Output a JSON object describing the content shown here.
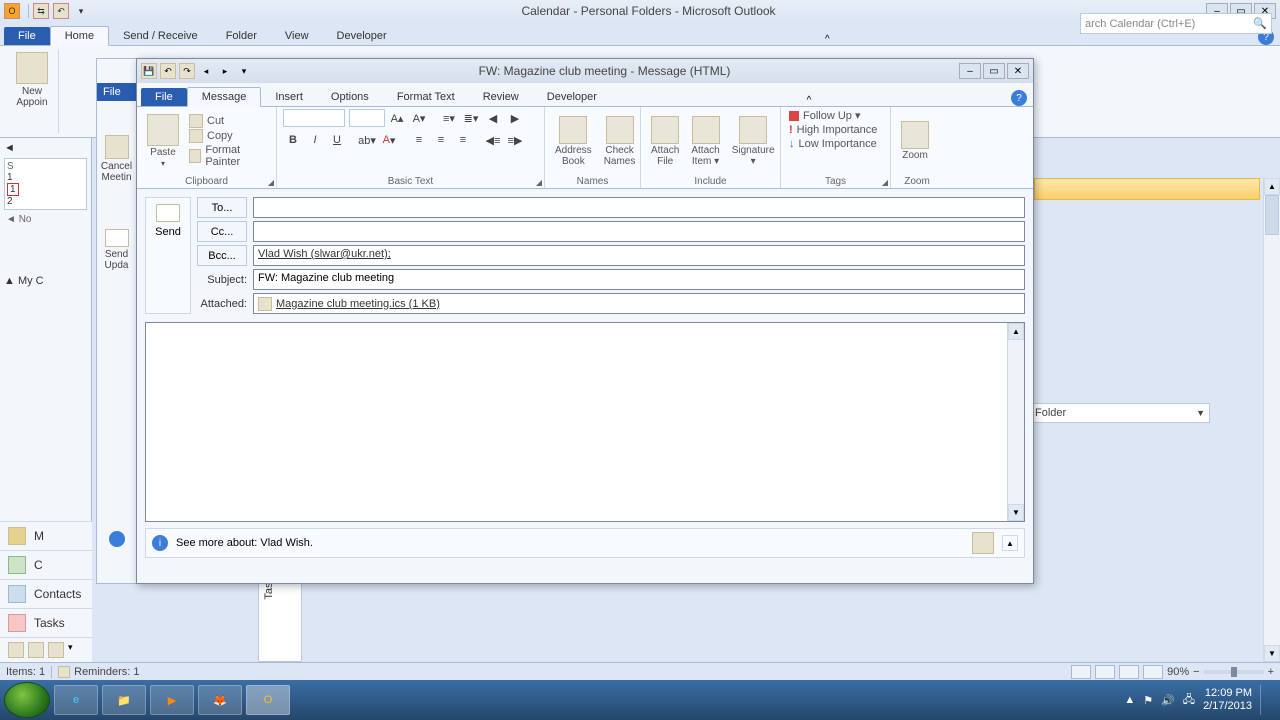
{
  "main": {
    "title": "Calendar - Personal Folders  -  Microsoft Outlook",
    "tabs": {
      "file": "File",
      "home": "Home",
      "send_receive": "Send / Receive",
      "folder": "Folder",
      "view": "View",
      "developer": "Developer"
    },
    "new_appt": "New\nAppoin",
    "search_placeholder": "arch Calendar (Ctrl+E)",
    "nav": {
      "mail": "M",
      "calendar": "C",
      "contacts": "Contacts",
      "tasks": "Tasks",
      "my_c": "My C",
      "nov": "No"
    },
    "folder_label": "Folder",
    "task_tab": "Task"
  },
  "peek": {
    "file": "File",
    "cancel": "Cancel\nMeetin",
    "update": "Send\nUpda"
  },
  "status": {
    "items": "Items: 1",
    "reminders": "Reminders: 1",
    "zoom": "90%"
  },
  "msg": {
    "title": "FW: Magazine club meeting  -  Message (HTML)",
    "tabs": {
      "file": "File",
      "message": "Message",
      "insert": "Insert",
      "options": "Options",
      "format": "Format Text",
      "review": "Review",
      "developer": "Developer"
    },
    "clipboard": {
      "paste": "Paste",
      "cut": "Cut",
      "copy": "Copy",
      "fp": "Format Painter",
      "label": "Clipboard"
    },
    "basic_text": "Basic Text",
    "names": {
      "ab": "Address\nBook",
      "cn": "Check\nNames",
      "label": "Names"
    },
    "include": {
      "af": "Attach\nFile",
      "ai": "Attach\nItem ▾",
      "sig": "Signature\n▾",
      "label": "Include"
    },
    "tags": {
      "fu": "Follow Up ▾",
      "hi": "High Importance",
      "lo": "Low Importance",
      "label": "Tags"
    },
    "zoom": {
      "btn": "Zoom",
      "label": "Zoom"
    },
    "send": "Send",
    "buttons": {
      "to": "To...",
      "cc": "Cc...",
      "bcc": "Bcc..."
    },
    "labels": {
      "subject": "Subject:",
      "attached": "Attached:"
    },
    "fields": {
      "to": "",
      "cc": "",
      "bcc": "Vlad Wish (slwar@ukr.net);",
      "subject": "FW: Magazine club meeting",
      "attached": "Magazine club meeting.ics (1 KB)"
    },
    "people": "See more about: Vlad Wish."
  },
  "tray": {
    "time": "12:09 PM",
    "date": "2/17/2013"
  }
}
